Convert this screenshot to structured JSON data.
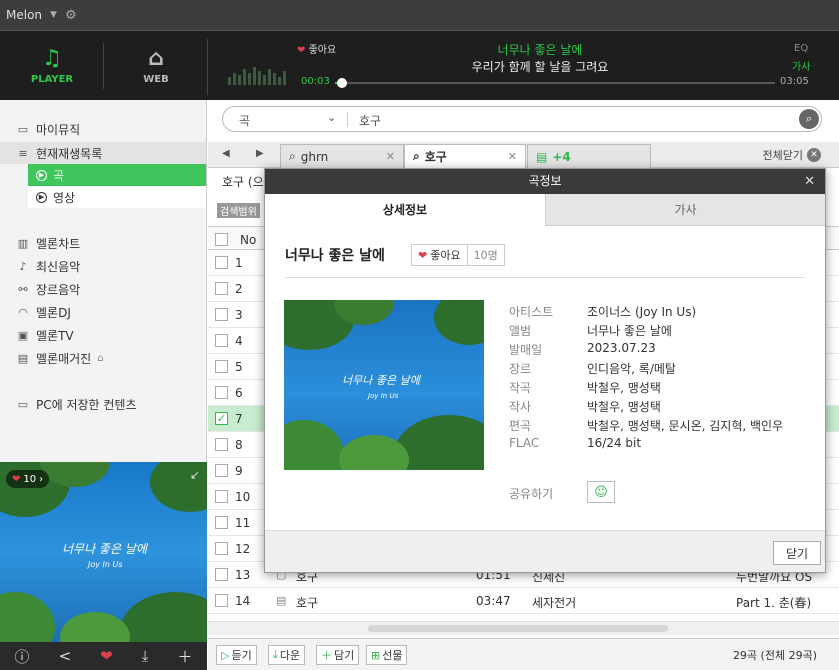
{
  "titlebar": {
    "app_name": "Melon"
  },
  "modes": {
    "player": "PLAYER",
    "web": "WEB"
  },
  "now_playing": {
    "like_label": "좋아요",
    "title": "너무나 좋은 날에",
    "lyric_line": "우리가 함께 할 날을 그려요",
    "current_time": "00:03",
    "total_time": "03:05",
    "progress": 0.01,
    "eq_label": "EQ",
    "lyrics_label": "가사"
  },
  "sidebar": {
    "items": [
      {
        "label": "마이뮤직",
        "icon": "my-music-icon"
      },
      {
        "label": "현재재생목록",
        "icon": "playlist-icon"
      },
      {
        "label": "멜론차트",
        "icon": "chart-icon"
      },
      {
        "label": "최신음악",
        "icon": "note-icon"
      },
      {
        "label": "장르음악",
        "icon": "genre-icon"
      },
      {
        "label": "멜론DJ",
        "icon": "headphone-icon"
      },
      {
        "label": "멜론TV",
        "icon": "tv-icon"
      },
      {
        "label": "멜론매거진",
        "icon": "magazine-icon"
      },
      {
        "label": "PC에 저장한 컨텐츠",
        "icon": "monitor-icon"
      }
    ],
    "sub_items": [
      {
        "label": "곡"
      },
      {
        "label": "영상"
      }
    ],
    "album_art": {
      "title": "너무나 좋은 날에",
      "sub": "Joy In Us",
      "like_count": "10"
    }
  },
  "search": {
    "category": "곡",
    "query": "호구"
  },
  "tabs": [
    {
      "label": "ghrn"
    },
    {
      "label": "호구"
    },
    {
      "label": "+4"
    }
  ],
  "close_all": "전체닫기",
  "result_label": "호구 (으",
  "scope_btn": "검색범위",
  "table": {
    "col_no": "No",
    "rows": [
      {
        "no": "1"
      },
      {
        "no": "2"
      },
      {
        "no": "3"
      },
      {
        "no": "4"
      },
      {
        "no": "5"
      },
      {
        "no": "6"
      },
      {
        "no": "7"
      },
      {
        "no": "8"
      },
      {
        "no": "9"
      },
      {
        "no": "10"
      },
      {
        "no": "11"
      },
      {
        "no": "12"
      },
      {
        "no": "13",
        "title": "호구",
        "time": "01:51",
        "artist": "신세진",
        "album": "두번말까요 OS"
      },
      {
        "no": "14",
        "title": "호구",
        "time": "03:47",
        "artist": "세자전거",
        "album": "Part 1. 춘(春)"
      }
    ]
  },
  "actions": [
    {
      "label": "듣기",
      "icon": "play-icon"
    },
    {
      "label": "다운",
      "icon": "download-icon"
    },
    {
      "label": "담기",
      "icon": "add-icon"
    },
    {
      "label": "선물",
      "icon": "gift-icon"
    }
  ],
  "count_text": "29곡 (전체 29곡)",
  "modal": {
    "title": "곡정보",
    "tab_detail": "상세정보",
    "tab_lyrics": "가사",
    "song_title": "너무나 좋은 날에",
    "like_label": "좋아요",
    "like_count": "10명",
    "cover_title": "너무나 좋은 날에",
    "cover_sub": "Joy In Us",
    "info": [
      {
        "label": "아티스트",
        "value": "조이너스 (Joy In Us)"
      },
      {
        "label": "앨범",
        "value": "너무나 좋은 날에"
      },
      {
        "label": "발매일",
        "value": "2023.07.23"
      },
      {
        "label": "장르",
        "value": "인디음악, 록/메탈"
      },
      {
        "label": "작곡",
        "value": "박철우, 맹성택"
      },
      {
        "label": "작사",
        "value": "박철우, 맹성택"
      },
      {
        "label": "편곡",
        "value": "박철우, 맹성택, 문시온, 김지혁, 백인우"
      },
      {
        "label": "FLAC",
        "value": "16/24 bit"
      }
    ],
    "share_label": "공유하기",
    "close_label": "닫기"
  },
  "colors": {
    "accent": "#2fc84a",
    "heart": "#e0404a",
    "dark": "#1e1e1e"
  }
}
